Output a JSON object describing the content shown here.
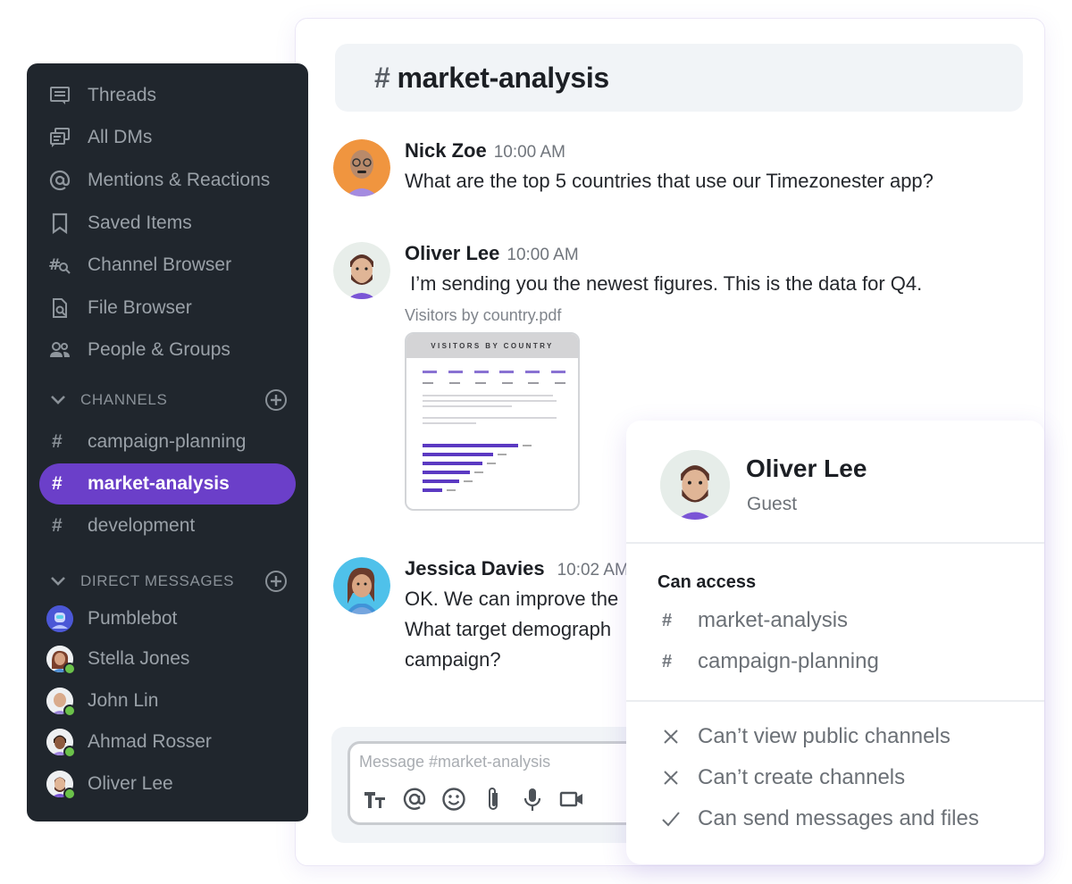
{
  "sidebar": {
    "nav": [
      {
        "label": "Threads",
        "icon": "threads-icon"
      },
      {
        "label": "All DMs",
        "icon": "all-dms-icon"
      },
      {
        "label": "Mentions & Reactions",
        "icon": "at-icon"
      },
      {
        "label": "Saved Items",
        "icon": "bookmark-icon"
      },
      {
        "label": "Channel Browser",
        "icon": "channel-search-icon"
      },
      {
        "label": "File Browser",
        "icon": "file-search-icon"
      },
      {
        "label": "People & Groups",
        "icon": "people-icon"
      }
    ],
    "channels_header": "CHANNELS",
    "channels": [
      {
        "label": "campaign-planning",
        "active": false
      },
      {
        "label": "market-analysis",
        "active": true
      },
      {
        "label": "development",
        "active": false
      }
    ],
    "dms_header": "DIRECT MESSAGES",
    "dms": [
      {
        "label": "Pumblebot",
        "online": false
      },
      {
        "label": "Stella Jones",
        "online": true
      },
      {
        "label": "John Lin",
        "online": true
      },
      {
        "label": "Ahmad Rosser",
        "online": true
      },
      {
        "label": "Oliver Lee",
        "online": true
      }
    ],
    "colors": {
      "background": "#20262d",
      "active": "#6b3fc9",
      "online": "#6bc24a"
    }
  },
  "channel": {
    "hash": "#",
    "name": "market-analysis"
  },
  "messages": [
    {
      "author": "Nick Zoe",
      "time": "10:00 AM",
      "lines": [
        "What are the top 5 countries that use our Timezonester app?"
      ]
    },
    {
      "author": "Oliver Lee",
      "time": "10:00 AM",
      "lines": [
        " I’m sending you the newest figures. This is the data for Q4."
      ],
      "attachment": {
        "name": "Visitors by country.pdf",
        "title": "VISITORS BY COUNTRY"
      }
    },
    {
      "author": "Jessica Davies",
      "time": "10:02 AM",
      "lines": [
        "OK. We can improve the",
        "What target demograph",
        "campaign?"
      ]
    }
  ],
  "composer": {
    "placeholder": "Message #market-analysis",
    "tools": [
      "text-format-icon",
      "mention-icon",
      "emoji-icon",
      "attach-icon",
      "microphone-icon",
      "video-icon"
    ]
  },
  "guest_card": {
    "name": "Oliver Lee",
    "role": "Guest",
    "can_access_label": "Can access",
    "channels": [
      "market-analysis",
      "campaign-planning"
    ],
    "permissions": [
      {
        "label": "Can’t view public channels",
        "allowed": false
      },
      {
        "label": "Can’t create channels",
        "allowed": false
      },
      {
        "label": "Can send messages and files",
        "allowed": true
      }
    ]
  }
}
